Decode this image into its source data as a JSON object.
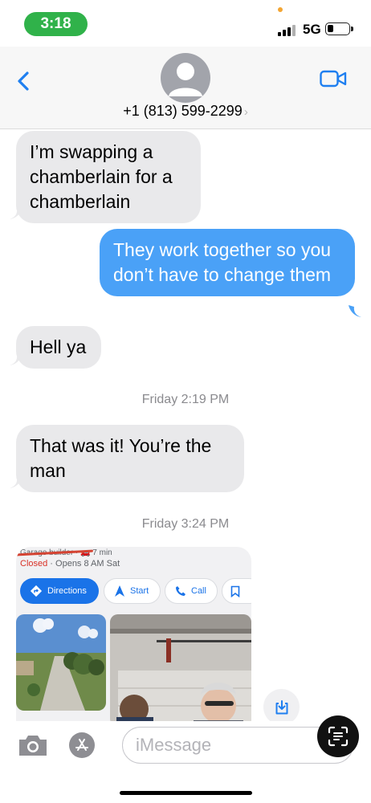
{
  "status_bar": {
    "time": "3:18",
    "network": "5G"
  },
  "header": {
    "contact": "+1 (813) 599-2299",
    "chevron": "›"
  },
  "messages": [
    {
      "dir": "received",
      "text": "I’m swapping a chamberlain for a chamberlain"
    },
    {
      "dir": "sent",
      "text": "They work together so you don’t have to change them"
    },
    {
      "dir": "received",
      "text": "Hell ya"
    },
    {
      "type": "timestamp",
      "text": "Friday 2:19 PM"
    },
    {
      "dir": "received",
      "text": "That was it! You’re the man"
    },
    {
      "type": "timestamp",
      "text": "Friday 3:24 PM"
    }
  ],
  "map_card": {
    "title": "Garage builder · 🚗 7 min",
    "status_closed": "Closed",
    "status_hours": " · Opens 8 AM Sat",
    "actions": [
      "Directions",
      "Start",
      "Call"
    ]
  },
  "composer": {
    "placeholder": "iMessage"
  },
  "colors": {
    "sent_bubble": "#4aa1f7",
    "received_bubble": "#e9e9eb",
    "maps_blue": "#1a73e8"
  }
}
